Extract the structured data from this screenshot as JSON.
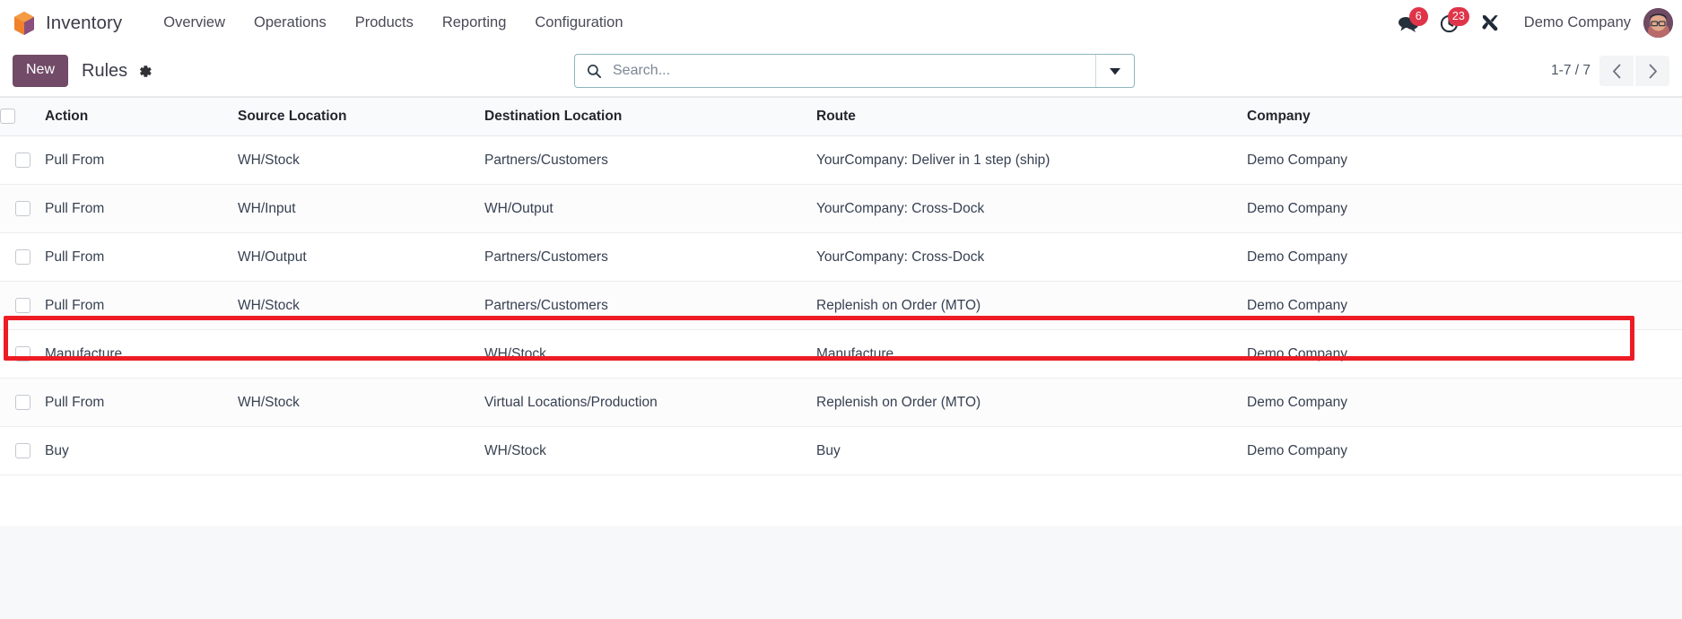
{
  "navbar": {
    "brand": "Inventory",
    "logo_icon": "inventory-cube-icon",
    "menu": [
      {
        "label": "Overview"
      },
      {
        "label": "Operations"
      },
      {
        "label": "Products"
      },
      {
        "label": "Reporting"
      },
      {
        "label": "Configuration"
      }
    ],
    "messages_icon": "chat-bubbles-icon",
    "messages_count": "6",
    "activities_icon": "clock-icon",
    "activities_count": "23",
    "debug_icon": "tools-icon",
    "company": "Demo Company",
    "avatar_icon": "user-avatar"
  },
  "control_panel": {
    "new_label": "New",
    "breadcrumb_title": "Rules",
    "settings_icon": "gear-icon",
    "search": {
      "placeholder": "Search...",
      "value": "",
      "icon": "search-icon",
      "toggle_icon": "chevron-down-icon"
    },
    "pager": {
      "range": "1-7 / 7",
      "prev_icon": "chevron-left-icon",
      "next_icon": "chevron-right-icon"
    }
  },
  "table": {
    "columns": [
      "Action",
      "Source Location",
      "Destination Location",
      "Route",
      "Company"
    ],
    "rows": [
      {
        "action": "Pull From",
        "source": "WH/Stock",
        "destination": "Partners/Customers",
        "route": "YourCompany: Deliver in 1 step (ship)",
        "company": "Demo Company",
        "highlighted": false
      },
      {
        "action": "Pull From",
        "source": "WH/Input",
        "destination": "WH/Output",
        "route": "YourCompany: Cross-Dock",
        "company": "Demo Company",
        "highlighted": false
      },
      {
        "action": "Pull From",
        "source": "WH/Output",
        "destination": "Partners/Customers",
        "route": "YourCompany: Cross-Dock",
        "company": "Demo Company",
        "highlighted": false
      },
      {
        "action": "Pull From",
        "source": "WH/Stock",
        "destination": "Partners/Customers",
        "route": "Replenish on Order (MTO)",
        "company": "Demo Company",
        "highlighted": false
      },
      {
        "action": "Manufacture",
        "source": "",
        "destination": "WH/Stock",
        "route": "Manufacture",
        "company": "Demo Company",
        "highlighted": false
      },
      {
        "action": "Pull From",
        "source": "WH/Stock",
        "destination": "Virtual Locations/Production",
        "route": "Replenish on Order (MTO)",
        "company": "Demo Company",
        "highlighted": true
      },
      {
        "action": "Buy",
        "source": "",
        "destination": "WH/Stock",
        "route": "Buy",
        "company": "Demo Company",
        "highlighted": false
      }
    ]
  },
  "colors": {
    "brand_purple": "#714b67",
    "badge_red": "#e0344a",
    "highlight_red": "#ed1c24",
    "search_border": "#8fb5bd"
  }
}
